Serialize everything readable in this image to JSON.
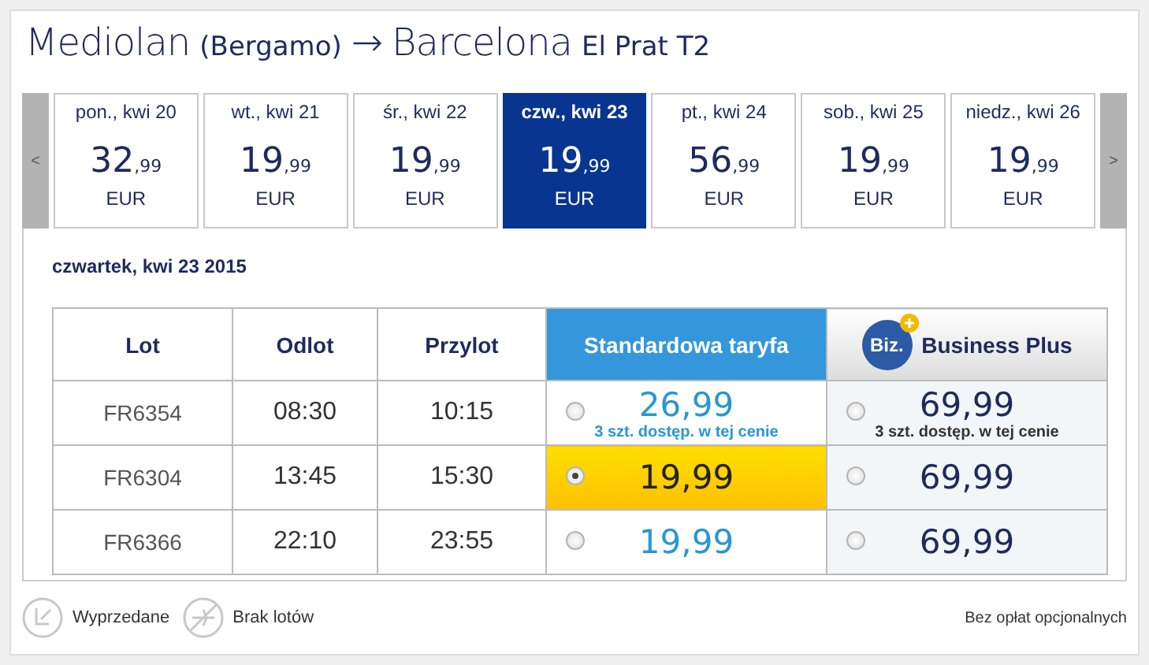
{
  "route": {
    "origin": "Mediolan",
    "origin_detail": "(Bergamo)",
    "arrow": "→",
    "destination": "Barcelona",
    "destination_detail": "El Prat T2"
  },
  "date_strip": {
    "prev": "<",
    "next": ">",
    "days": [
      {
        "label": "pon., kwi 20",
        "amount": "32",
        "cents": ",99",
        "currency": "EUR",
        "selected": false
      },
      {
        "label": "wt., kwi 21",
        "amount": "19",
        "cents": ",99",
        "currency": "EUR",
        "selected": false
      },
      {
        "label": "śr., kwi 22",
        "amount": "19",
        "cents": ",99",
        "currency": "EUR",
        "selected": false
      },
      {
        "label": "czw., kwi 23",
        "amount": "19",
        "cents": ",99",
        "currency": "EUR",
        "selected": true
      },
      {
        "label": "pt., kwi 24",
        "amount": "56",
        "cents": ",99",
        "currency": "EUR",
        "selected": false
      },
      {
        "label": "sob., kwi 25",
        "amount": "19",
        "cents": ",99",
        "currency": "EUR",
        "selected": false
      },
      {
        "label": "niedz., kwi 26",
        "amount": "19",
        "cents": ",99",
        "currency": "EUR",
        "selected": false
      }
    ]
  },
  "selected_date": "czwartek, kwi 23 2015",
  "table": {
    "columns": [
      "Lot",
      "Odlot",
      "Przylot"
    ],
    "standard_header": "Standardowa taryfa",
    "business_logo": "Biz.",
    "business_header": "Business Plus",
    "rows": [
      {
        "flight": "FR6354",
        "departure": "08:30",
        "arrival": "10:15",
        "standard": {
          "amount": "26",
          "cents": ",99",
          "selected": false,
          "note": "3 szt. dostęp. w tej cenie"
        },
        "business": {
          "amount": "69",
          "cents": ",99",
          "selected": false,
          "note": "3 szt. dostęp. w tej cenie"
        }
      },
      {
        "flight": "FR6304",
        "departure": "13:45",
        "arrival": "15:30",
        "standard": {
          "amount": "19",
          "cents": ",99",
          "selected": true
        },
        "business": {
          "amount": "69",
          "cents": ",99",
          "selected": false
        }
      },
      {
        "flight": "FR6366",
        "departure": "22:10",
        "arrival": "23:55",
        "standard": {
          "amount": "19",
          "cents": ",99",
          "selected": false
        },
        "business": {
          "amount": "69",
          "cents": ",99",
          "selected": false
        }
      }
    ]
  },
  "legend": [
    {
      "kind": "sold_out",
      "label": "Wyprzedane"
    },
    {
      "kind": "no_flights",
      "label": "Brak lotów"
    }
  ],
  "footer_note": "Bez opłat opcjonalnych"
}
